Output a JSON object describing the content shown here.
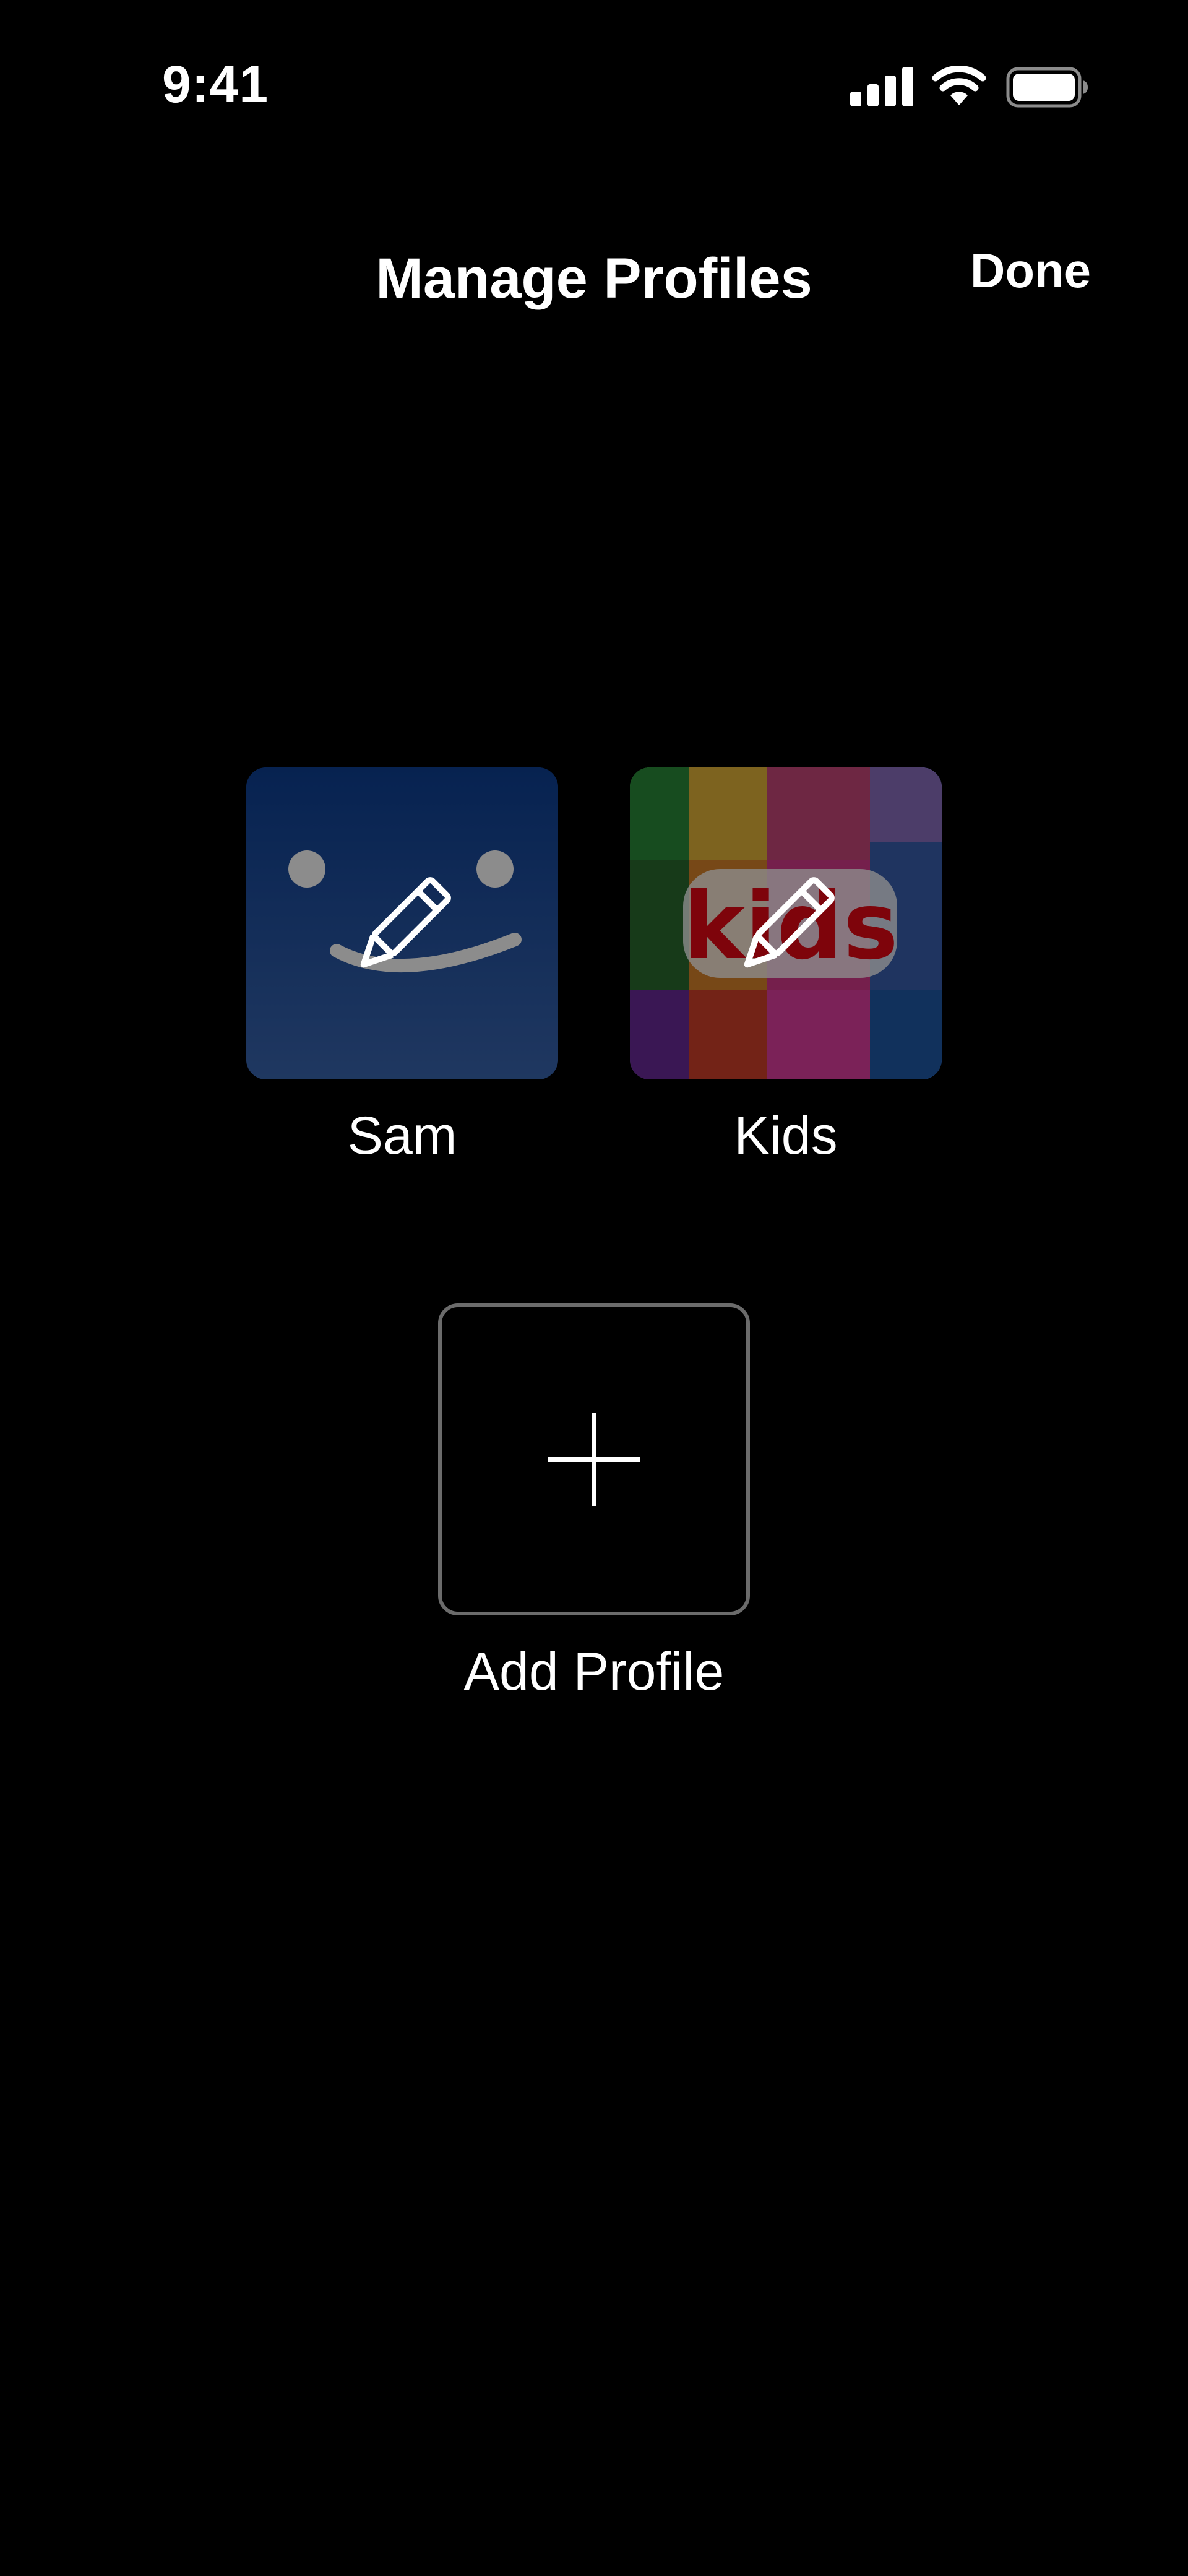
{
  "status_bar": {
    "time": "9:41",
    "icons": [
      "signal-icon",
      "wifi-icon",
      "battery-icon"
    ]
  },
  "header": {
    "title": "Manage Profiles",
    "done_label": "Done"
  },
  "profiles": [
    {
      "name": "Sam",
      "avatar": "smile-face-avatar",
      "edit_icon": "pencil-icon",
      "color": "#0d3d86"
    },
    {
      "name": "Kids",
      "avatar": "kids-rainbow-avatar",
      "avatar_text": "kids",
      "edit_icon": "pencil-icon",
      "color": "#e50914"
    }
  ],
  "add_profile": {
    "label": "Add Profile",
    "icon": "plus-icon"
  }
}
